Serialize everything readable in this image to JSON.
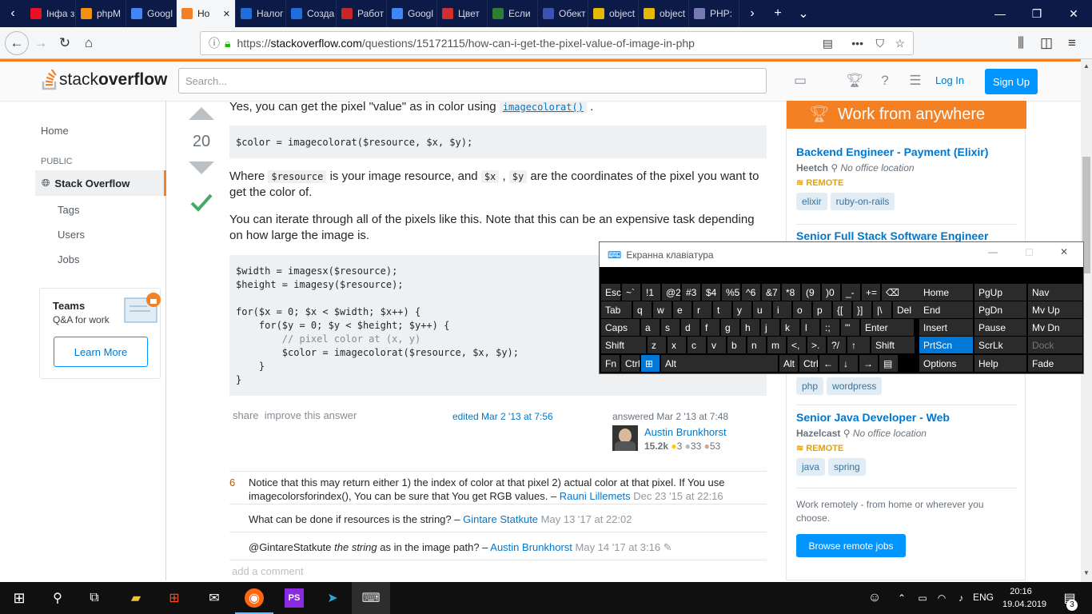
{
  "browser": {
    "tabs": [
      {
        "label": "Інфа з",
        "color": "#e81123"
      },
      {
        "label": "phpM",
        "color": "#f29111"
      },
      {
        "label": "Googl",
        "color": "#4285f4"
      },
      {
        "label": "Но",
        "color": "#f48024"
      },
      {
        "label": "Налог",
        "color": "#1e6fd9"
      },
      {
        "label": "Созда",
        "color": "#1e6fd9"
      },
      {
        "label": "Работ",
        "color": "#c62828"
      },
      {
        "label": "Googl",
        "color": "#4285f4"
      },
      {
        "label": "Цвет",
        "color": "#d32f2f"
      },
      {
        "label": "Если",
        "color": "#2e7d32"
      },
      {
        "label": "Обект",
        "color": "#3f51b5"
      },
      {
        "label": "object",
        "color": "#e6b800"
      },
      {
        "label": "object",
        "color": "#e6b800"
      },
      {
        "label": "PHP:",
        "color": "#777bb3"
      }
    ],
    "url_prefix": "https://",
    "url_host": "stackoverflow.com",
    "url_path": "/questions/15172115/how-can-i-get-the-pixel-value-of-image-in-php"
  },
  "so_header": {
    "logo_a": "stack",
    "logo_b": "overflow",
    "search_placeholder": "Search...",
    "login": "Log In",
    "signup": "Sign Up"
  },
  "leftnav": {
    "home": "Home",
    "public": "PUBLIC",
    "stackoverflow": "Stack Overflow",
    "tags": "Tags",
    "users": "Users",
    "jobs": "Jobs",
    "teams_title": "Teams",
    "teams_sub": "Q&A for work",
    "learn_more": "Learn More"
  },
  "answer": {
    "votes": "20",
    "intro": "Yes, you can get the pixel \"value\" as in color using",
    "intro_code": "imagecolorat()",
    "code1": "$color = imagecolorat($resource, $x, $y);",
    "where_1": "Where",
    "where_code1": "$resource",
    "where_2": "is your image resource, and",
    "where_code2": "$x",
    "where_code3": "$y",
    "where_3": "are the coordinates of the pixel you want to get the color of.",
    "iterate": "You can iterate through all of the pixels like this. Note that this can be an expensive task depending on how large the image is.",
    "code2_lines": [
      "$width = imagesx($resource);",
      "$height = imagesy($resource);",
      "",
      "for($x = 0; $x < $width; $x++) {",
      "    for($y = 0; $y < $height; $y++) {",
      "        // pixel color at (x, y)",
      "        $color = imagecolorat($resource, $x, $y);",
      "    }",
      "}"
    ],
    "share": "share",
    "improve": "improve this answer",
    "edited": "edited Mar 2 '13 at 7:56",
    "answered": "answered Mar 2 '13 at 7:48",
    "author": "Austin Brunkhorst",
    "rep": "15.2k",
    "gold": "3",
    "silver": "33",
    "bronze": "53"
  },
  "comments": [
    {
      "score": "6",
      "text": "Notice that this may return either 1) the index of color at that pixel 2) actual color at that pixel. If You use imagecolorsforindex(), You can be sure that You get RGB values. – ",
      "user": "Rauni Lillemets",
      "date": "Dec 23 '15 at 22:16"
    },
    {
      "score": "",
      "text": "What can be done if resources is the string? – ",
      "user": "Gintare Statkute",
      "date": "May 13 '17 at 22:02"
    },
    {
      "score": "",
      "text_a": "@GintareStatkute ",
      "text_em": "the string",
      "text_b": " as in the image path? – ",
      "user": "Austin Brunkhorst",
      "date": "May 14 '17 at 3:16"
    }
  ],
  "add_comment": "add a comment",
  "rside": {
    "banner": "Work from anywhere",
    "jobs": [
      {
        "title": "Backend Engineer - Payment (Elixir)",
        "company": "Heetch",
        "location": "No office location",
        "remote": "REMOTE",
        "tags": [
          "elixir",
          "ruby-on-rails"
        ]
      },
      {
        "title": "Senior Full Stack Software Engineer",
        "tags": [
          "php",
          "wordpress"
        ]
      },
      {
        "title": "Senior Java Developer - Web",
        "company": "Hazelcast",
        "location": "No office location",
        "remote": "REMOTE",
        "tags": [
          "java",
          "spring"
        ]
      }
    ],
    "footer_text": "Work remotely - from home or wherever you choose.",
    "browse": "Browse remote jobs"
  },
  "osk": {
    "title": "Екранна клавіатура",
    "rows": [
      [
        "Esc",
        "~`",
        "!1",
        "@2",
        "#3",
        "$4",
        "%5",
        "^6",
        "&7",
        "*8",
        "(9",
        ")0",
        "_-",
        "+=",
        "⌫"
      ],
      [
        "Tab",
        "q",
        "w",
        "e",
        "r",
        "t",
        "y",
        "u",
        "i",
        "o",
        "p",
        "{[",
        "}]",
        "|\\",
        "Del"
      ],
      [
        "Caps",
        "a",
        "s",
        "d",
        "f",
        "g",
        "h",
        "j",
        "k",
        "l",
        ":;",
        "\"'",
        "Enter"
      ],
      [
        "Shift",
        "z",
        "x",
        "c",
        "v",
        "b",
        "n",
        "m",
        "<,",
        ">.",
        "?/",
        "↑",
        "Shift"
      ],
      [
        "Fn",
        "Ctrl",
        "⊞",
        "Alt",
        "Alt",
        "Ctrl",
        "←",
        "↓",
        "→",
        "▤"
      ]
    ],
    "nav": [
      [
        "Home",
        "PgUp",
        "Nav"
      ],
      [
        "End",
        "PgDn",
        "Mv Up"
      ],
      [
        "Insert",
        "Pause",
        "Mv Dn"
      ],
      [
        "PrtScn",
        "ScrLk",
        "Dock"
      ],
      [
        "Options",
        "Help",
        "Fade"
      ]
    ]
  },
  "taskbar": {
    "lang": "ENG",
    "time": "20:16",
    "date": "19.04.2019",
    "notif": "3"
  }
}
